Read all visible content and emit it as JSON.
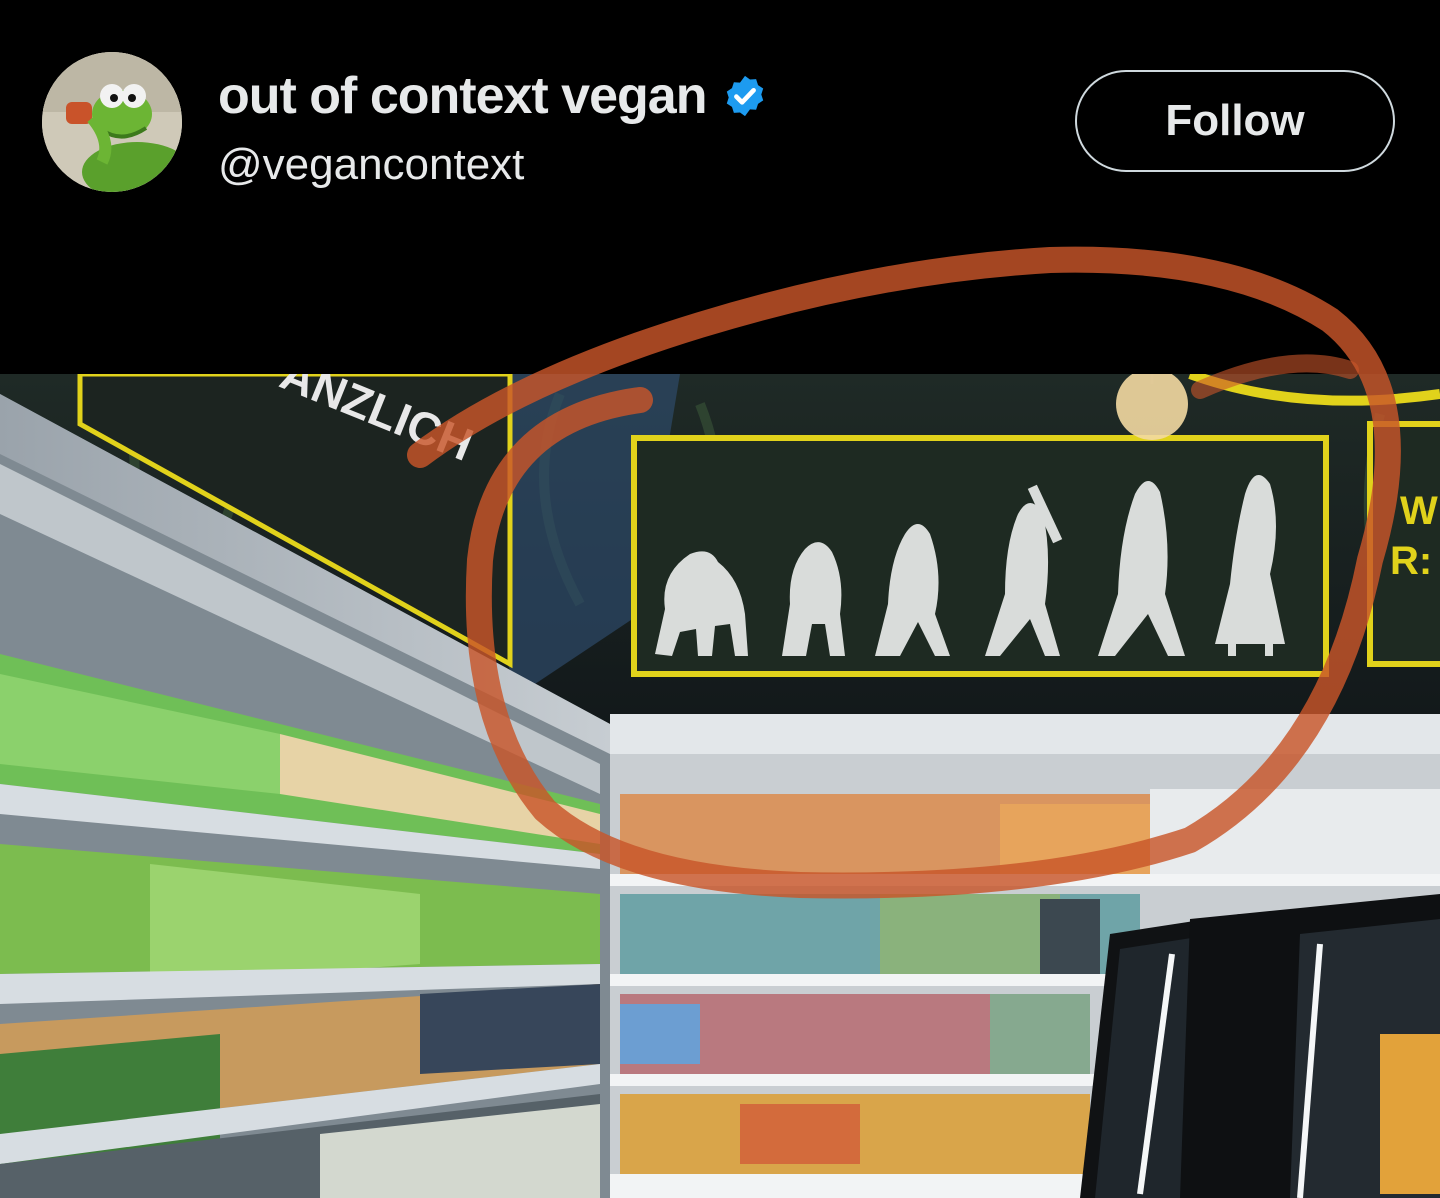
{
  "post": {
    "author": {
      "display_name": "out of context vegan",
      "handle": "@vegancontext",
      "verified": true,
      "avatar_icon": "kermit-drinking-tea-avatar"
    },
    "follow_label": "Follow"
  },
  "photo": {
    "signs": {
      "left_banner_text": "ANZLICH",
      "right_banner_text_line1": "W",
      "right_banner_text_line2": "R:"
    },
    "annotation_color": "#c8552a",
    "sign_frame_color": "#e1d21b",
    "evolution_figures": 6
  },
  "colors": {
    "background": "#000000",
    "text": "#e7e9ea",
    "verified_blue": "#1d9bf0",
    "follow_border": "#cfd9de"
  }
}
